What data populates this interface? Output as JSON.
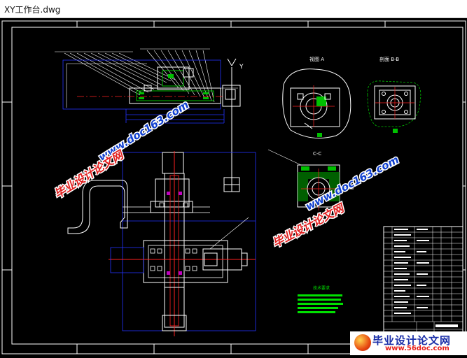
{
  "window": {
    "title": "XY工作台.dwg"
  },
  "drawing": {
    "axis_label": "Y",
    "view_a_label": "视图 A",
    "view_bb_label": "剖面 B-B",
    "view_cc_label": "C-C",
    "tech_requirements_label": "技术要求"
  },
  "watermarks": {
    "text_cn": "毕业设计论文网",
    "text_url": "www.doc163.com"
  },
  "logo": {
    "text_cn": "毕业设计论文网",
    "url": "www.56doc.com"
  },
  "colors": {
    "background": "#000000",
    "frame": "#ffffff",
    "dim_blue": "#2233ff",
    "center_red": "#ff2020",
    "hatch_green": "#00c000",
    "tech_green": "#00e000",
    "magenta": "#c000c0"
  }
}
